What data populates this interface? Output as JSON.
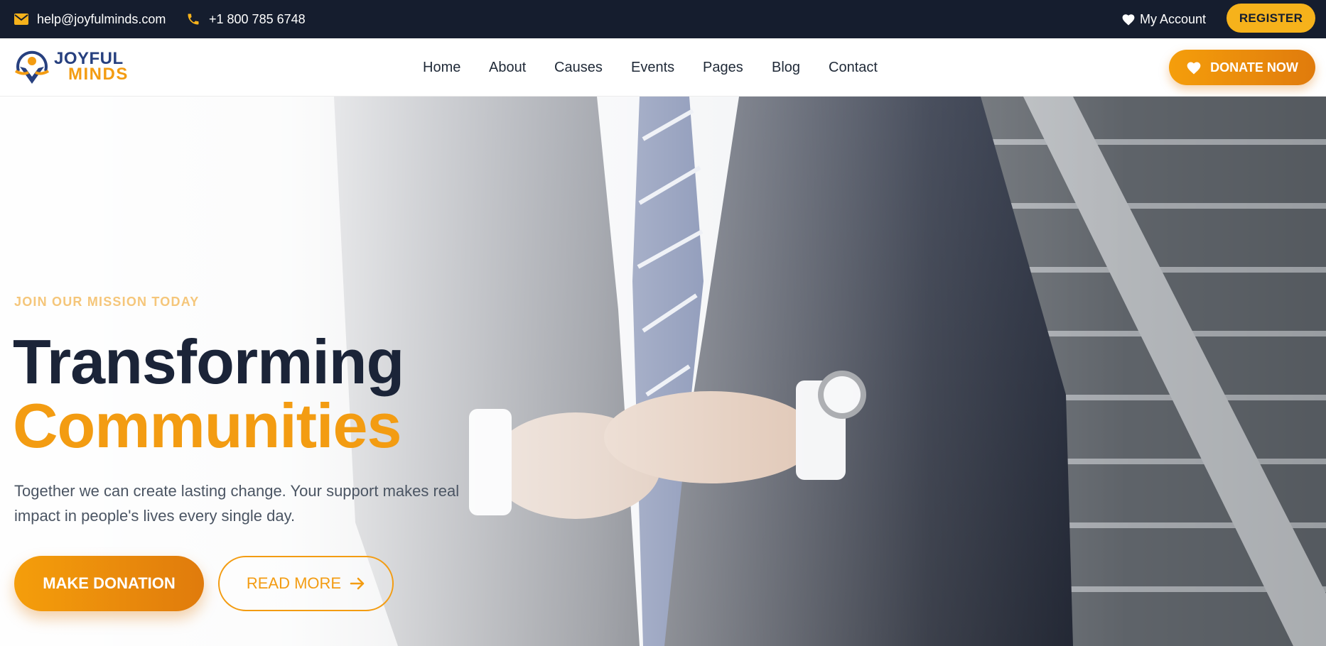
{
  "topbar": {
    "email": "help@joyfulminds.com",
    "phone": "+1 800 785 6748",
    "account_label": "My Account",
    "register_label": "REGISTER",
    "icons": [
      "mail-icon",
      "phone-icon",
      "heart-icon"
    ]
  },
  "brand": {
    "line1": "JOYFUL",
    "line2": "MINDS"
  },
  "nav": {
    "items": [
      "Home",
      "About",
      "Causes",
      "Events",
      "Pages",
      "Blog",
      "Contact"
    ],
    "donate_label": "DONATE NOW"
  },
  "hero": {
    "eyebrow": "JOIN OUR MISSION TODAY",
    "title_line1": "Transforming",
    "title_line2": "Communities",
    "description": "Together we can create lasting change. Your support makes real impact in people's lives every single day.",
    "primary_button": "MAKE DONATION",
    "secondary_button": "READ MORE"
  },
  "colors": {
    "accent": "#f39c12",
    "dark": "#151d2e",
    "heading": "#1b2438",
    "register": "#f6b21b"
  }
}
